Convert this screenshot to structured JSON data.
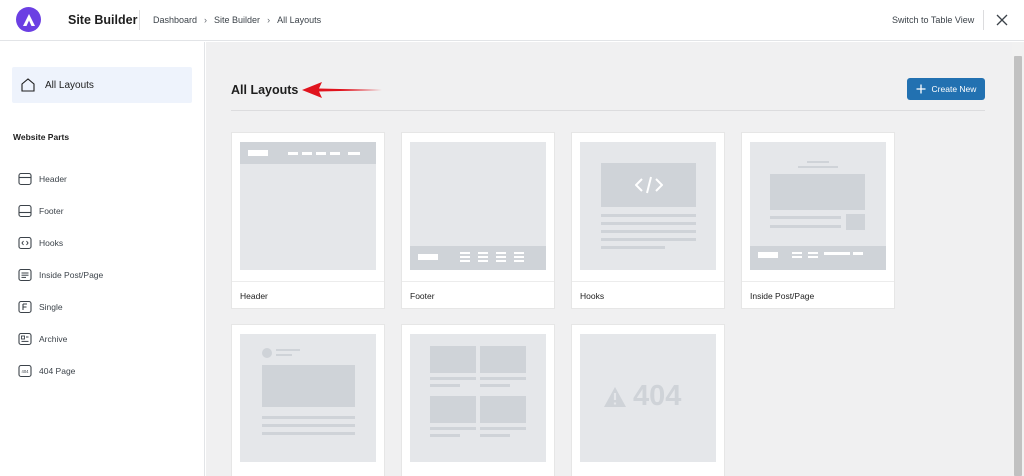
{
  "header": {
    "app_title": "Site Builder",
    "breadcrumb": [
      "Dashboard",
      "Site Builder",
      "All Layouts"
    ],
    "switch_view_label": "Switch to Table View",
    "logo_icon": "astra-logo-icon",
    "close_icon": "close-icon"
  },
  "sidebar": {
    "all_layouts_label": "All Layouts",
    "section_title": "Website Parts",
    "items": [
      {
        "label": "Header",
        "icon": "header-icon"
      },
      {
        "label": "Footer",
        "icon": "footer-icon"
      },
      {
        "label": "Hooks",
        "icon": "hooks-icon"
      },
      {
        "label": "Inside Post/Page",
        "icon": "inside-post-icon"
      },
      {
        "label": "Single",
        "icon": "single-icon"
      },
      {
        "label": "Archive",
        "icon": "archive-icon"
      },
      {
        "label": "404 Page",
        "icon": "404-icon"
      }
    ]
  },
  "main": {
    "title": "All Layouts",
    "create_button_label": "Create New",
    "cards": [
      {
        "label": "Header"
      },
      {
        "label": "Footer"
      },
      {
        "label": "Hooks"
      },
      {
        "label": "Inside Post/Page"
      },
      {
        "label": ""
      },
      {
        "label": ""
      },
      {
        "label": "",
        "thumb_text": "404"
      }
    ]
  },
  "colors": {
    "brand": "#6b3fe3",
    "primary_button": "#2271b1",
    "active_item_bg": "#eef3fc",
    "annotation_arrow": "#e0141e"
  }
}
